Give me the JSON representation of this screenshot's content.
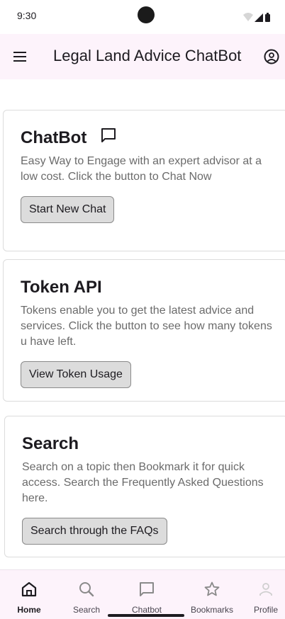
{
  "status_bar": {
    "time": "9:30"
  },
  "app_bar": {
    "title": "Legal Land Advice ChatBot",
    "menu_icon": "menu-icon",
    "account_icon": "account-circle-icon"
  },
  "cards": [
    {
      "title": "ChatBot",
      "icon": "chat-bubble-icon",
      "description": "Easy Way to Engage with an expert advisor at a low cost. Click the button to Chat Now",
      "button": "Start New Chat"
    },
    {
      "title": "Token API",
      "description": "Tokens enable you to get the latest advice and services. Click the button to see how many tokens u have left.",
      "button": "View Token Usage"
    },
    {
      "title": "Search",
      "description": "Search on a topic then Bookmark it for quick access. Search the Frequently Asked Questions here.",
      "button": "Search through the FAQs"
    }
  ],
  "bottom_nav": {
    "items": [
      {
        "label": "Home",
        "icon": "home-icon",
        "active": true
      },
      {
        "label": "Search",
        "icon": "search-icon"
      },
      {
        "label": "Chatbot",
        "icon": "chat-bubble-icon"
      },
      {
        "label": "Bookmarks",
        "icon": "star-icon"
      },
      {
        "label": "Profile",
        "icon": "person-icon",
        "disabled": true
      }
    ]
  },
  "colors": {
    "app_bar_bg": "#fdf3fb",
    "button_bg": "#dcdcdc",
    "text_primary": "#1d1b20",
    "text_secondary": "#6b6b6b"
  }
}
